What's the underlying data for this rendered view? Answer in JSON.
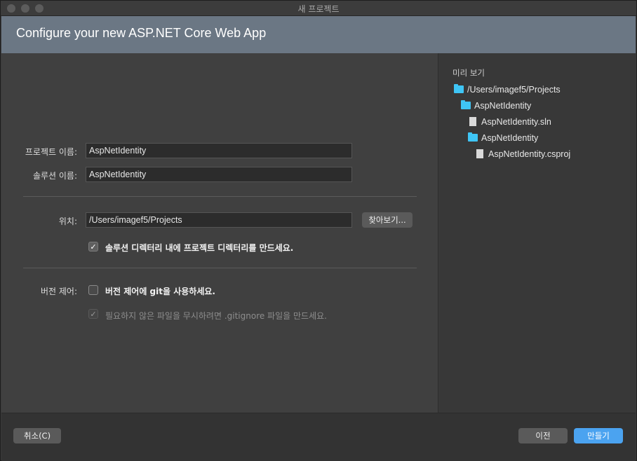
{
  "window": {
    "title": "새 프로젝트"
  },
  "header": {
    "title": "Configure your new ASP.NET Core Web App"
  },
  "form": {
    "project_name_label": "프로젝트 이름:",
    "project_name_value": "AspNetIdentity",
    "solution_name_label": "솔루션 이름:",
    "solution_name_value": "AspNetIdentity",
    "location_label": "위치:",
    "location_value": "/Users/imagef5/Projects",
    "browse_label": "찾아보기...",
    "create_dir_label": "솔루션 디렉터리 내에 프로젝트 디렉터리를 만드세요.",
    "create_dir_checked": true,
    "vcs_label": "버전 제어:",
    "use_git_label": "버전 제어에 git을 사용하세요.",
    "use_git_checked": false,
    "gitignore_label": "필요하지 않은 파일을 무시하려면 .gitignore 파일을 만드세요.",
    "gitignore_checked": true,
    "gitignore_enabled": false
  },
  "preview": {
    "heading": "미리 보기",
    "tree": [
      {
        "type": "folder",
        "name": "/Users/imagef5/Projects",
        "depth": 0
      },
      {
        "type": "folder",
        "name": "AspNetIdentity",
        "depth": 1
      },
      {
        "type": "file",
        "name": "AspNetIdentity.sln",
        "depth": 2
      },
      {
        "type": "folder",
        "name": "AspNetIdentity",
        "depth": 2
      },
      {
        "type": "file",
        "name": "AspNetIdentity.csproj",
        "depth": 3
      }
    ]
  },
  "footer": {
    "cancel_label": "취소(C)",
    "back_label": "이전",
    "create_label": "만들기"
  },
  "colors": {
    "header_bg": "#6b7784",
    "folder_icon": "#3fc5f5",
    "primary_button": "#4ba3f0"
  }
}
